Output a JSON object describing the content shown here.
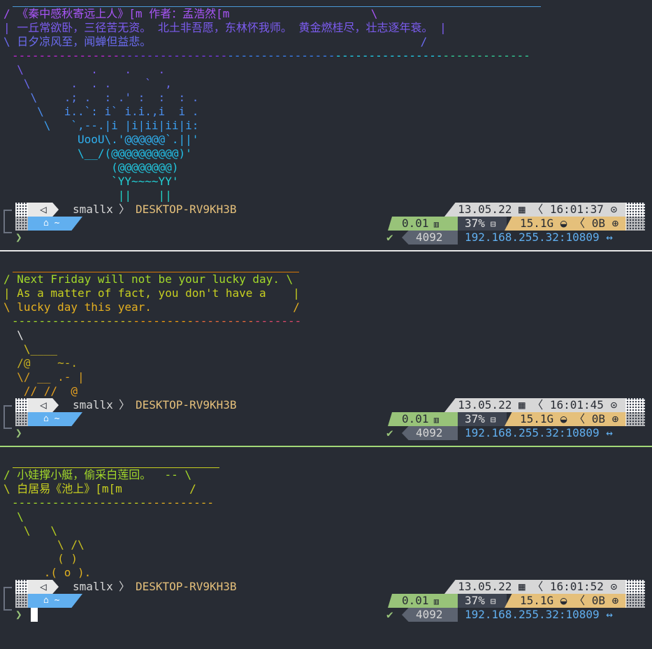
{
  "blocks": [
    {
      "cowsay": {
        "top_bar_color": "#4a9ad8",
        "lines": [
          {
            "text": "/ 《秦中感秋寄远上人》[m 作者：孟浩然[m                     \\",
            "color": "#a855f7"
          },
          {
            "text": "| 一丘常欲卧，三径苦无资。 北土非吾愿，东林怀我师。 黄金燃桂尽，壮志逐年衰。 |",
            "color": "#7c5cf0"
          },
          {
            "text": "\\ 日夕凉风至，闻蝉但益悲。                                        /",
            "color": "#6b6bf0"
          }
        ],
        "dash_line": "-----------------------------------------------------------------------------",
        "dash_colors": [
          "#c026d3",
          "#7c3aed",
          "#3b82f6",
          "#22d3ee",
          "#34d399"
        ]
      },
      "art": [
        {
          "text": "  \\          .    .    .",
          "color": "#7c5cf0"
        },
        {
          "text": "   \\      .  . .     `  ,",
          "color": "#6b6bf0"
        },
        {
          "text": "    \\    .; .  : .' :  :  : .",
          "color": "#5b7ff0"
        },
        {
          "text": "     \\   i..`: i` i.i.,i  i .",
          "color": "#4a8ff0"
        },
        {
          "text": "      \\   `,--.|i |i|ii|ii|i:",
          "color": "#3b9ff0"
        },
        {
          "text": "           UooU\\.'@@@@@@`.||'",
          "color": "#2fb0f0"
        },
        {
          "text": "           \\__/(@@@@@@@@@@)'",
          "color": "#22c0e8"
        },
        {
          "text": "                (@@@@@@@@)",
          "color": "#22c8e0"
        },
        {
          "text": "                `YY~~~~YY'",
          "color": "#22cfd5"
        },
        {
          "text": "                 ||    ||",
          "color": "#22d3c8"
        }
      ],
      "prompt": {
        "user": "smallx",
        "host": "DESKTOP-RV9KH3B",
        "dir": "~",
        "date": "13.05.22",
        "time": "16:01:37",
        "load": "0.01",
        "ram_pct": "37%",
        "ram_free": "15.1G",
        "swap": "0B",
        "history": "4092",
        "ip": "192.168.255.32:10809",
        "check": "✔",
        "arrow": "❯",
        "separator_color": "#e8e8e8"
      }
    },
    {
      "cowsay": {
        "top_bar_color": "#d97706",
        "lines": [
          {
            "text": "/ Next Friday will not be your lucky day. \\",
            "color": "#a3d92a",
            "accent": "#f59e0b"
          },
          {
            "text": "| As a matter of fact, you don't have a    |",
            "color": "#c8d020",
            "accent": "#f59e0b"
          },
          {
            "text": "\\ lucky day this year.                     /",
            "color": "#e5b020",
            "accent": "#ef6b3a"
          }
        ],
        "dash_line": "-------------------------------------------",
        "dash_colors": [
          "#a3d92a",
          "#d4c020",
          "#f59e0b",
          "#ef6b3a",
          "#e0486b"
        ]
      },
      "art": [
        {
          "text": "  \\",
          "color": "#e5e5e5"
        },
        {
          "text": "   \\____",
          "color": "#d4c020"
        },
        {
          "text": "  /@    ~-.",
          "color": "#c8b020"
        },
        {
          "text": "  \\/ __ .- |",
          "color": "#d9a020"
        },
        {
          "text": "   // //  @",
          "color": "#e5a020"
        }
      ],
      "prompt": {
        "user": "smallx",
        "host": "DESKTOP-RV9KH3B",
        "dir": "~",
        "date": "13.05.22",
        "time": "16:01:45",
        "load": "0.01",
        "ram_pct": "37%",
        "ram_free": "15.1G",
        "swap": "0B",
        "history": "4092",
        "ip": "192.168.255.32:10809",
        "check": "✔",
        "arrow": "❯",
        "separator_color": "#a3d977"
      }
    },
    {
      "cowsay": {
        "top_bar_color": "#c8d020",
        "lines": [
          {
            "text": "/ 小娃撑小艇，偷采白莲回。  -- \\",
            "color": "#a3d92a",
            "accent": "#e5b020"
          },
          {
            "text": "\\ 白居易《池上》[m[m          /",
            "color": "#c8d020",
            "accent": "#e5b020"
          }
        ],
        "dash_line": "------------------------------",
        "dash_colors": [
          "#a3d92a",
          "#c8d020",
          "#e5b020"
        ]
      },
      "art": [
        {
          "text": "  \\",
          "color": "#a3d92a"
        },
        {
          "text": "   \\   \\",
          "color": "#b8d020"
        },
        {
          "text": "        \\ /\\",
          "color": "#c8c020"
        },
        {
          "text": "        ( )",
          "color": "#d4b820"
        },
        {
          "text": "      .( o ).",
          "color": "#e0b020"
        }
      ],
      "prompt": {
        "user": "smallx",
        "host": "DESKTOP-RV9KH3B",
        "dir": "~",
        "date": "13.05.22",
        "time": "16:01:52",
        "load": "0.01",
        "ram_pct": "37%",
        "ram_free": "15.1G",
        "swap": "0B",
        "history": "4092",
        "ip": "192.168.255.32:10809",
        "check": "✔",
        "arrow": "❯",
        "separator_color": null
      }
    }
  ],
  "icons": {
    "os_icon": "linux-icon",
    "home_icon": "home-icon",
    "calendar_icon": "calendar-icon",
    "clock_icon": "clock-icon",
    "load_icon": "chart-icon",
    "ram_icon": "memory-icon",
    "swap_icon": "swap-icon",
    "disk_icon": "disk-icon",
    "ip_icon": "network-icon"
  },
  "colors": {
    "background": "#282c34",
    "prompt_dark": "#3e4450",
    "prompt_blue": "#61afef",
    "prompt_text": "#e5c07b",
    "date_bg": "#d7d7d7",
    "load_bg": "#98c379",
    "ram_bg": "#e5c07b",
    "history_bg": "#5c6370",
    "ip_text": "#61afef",
    "check": "#98c379"
  }
}
